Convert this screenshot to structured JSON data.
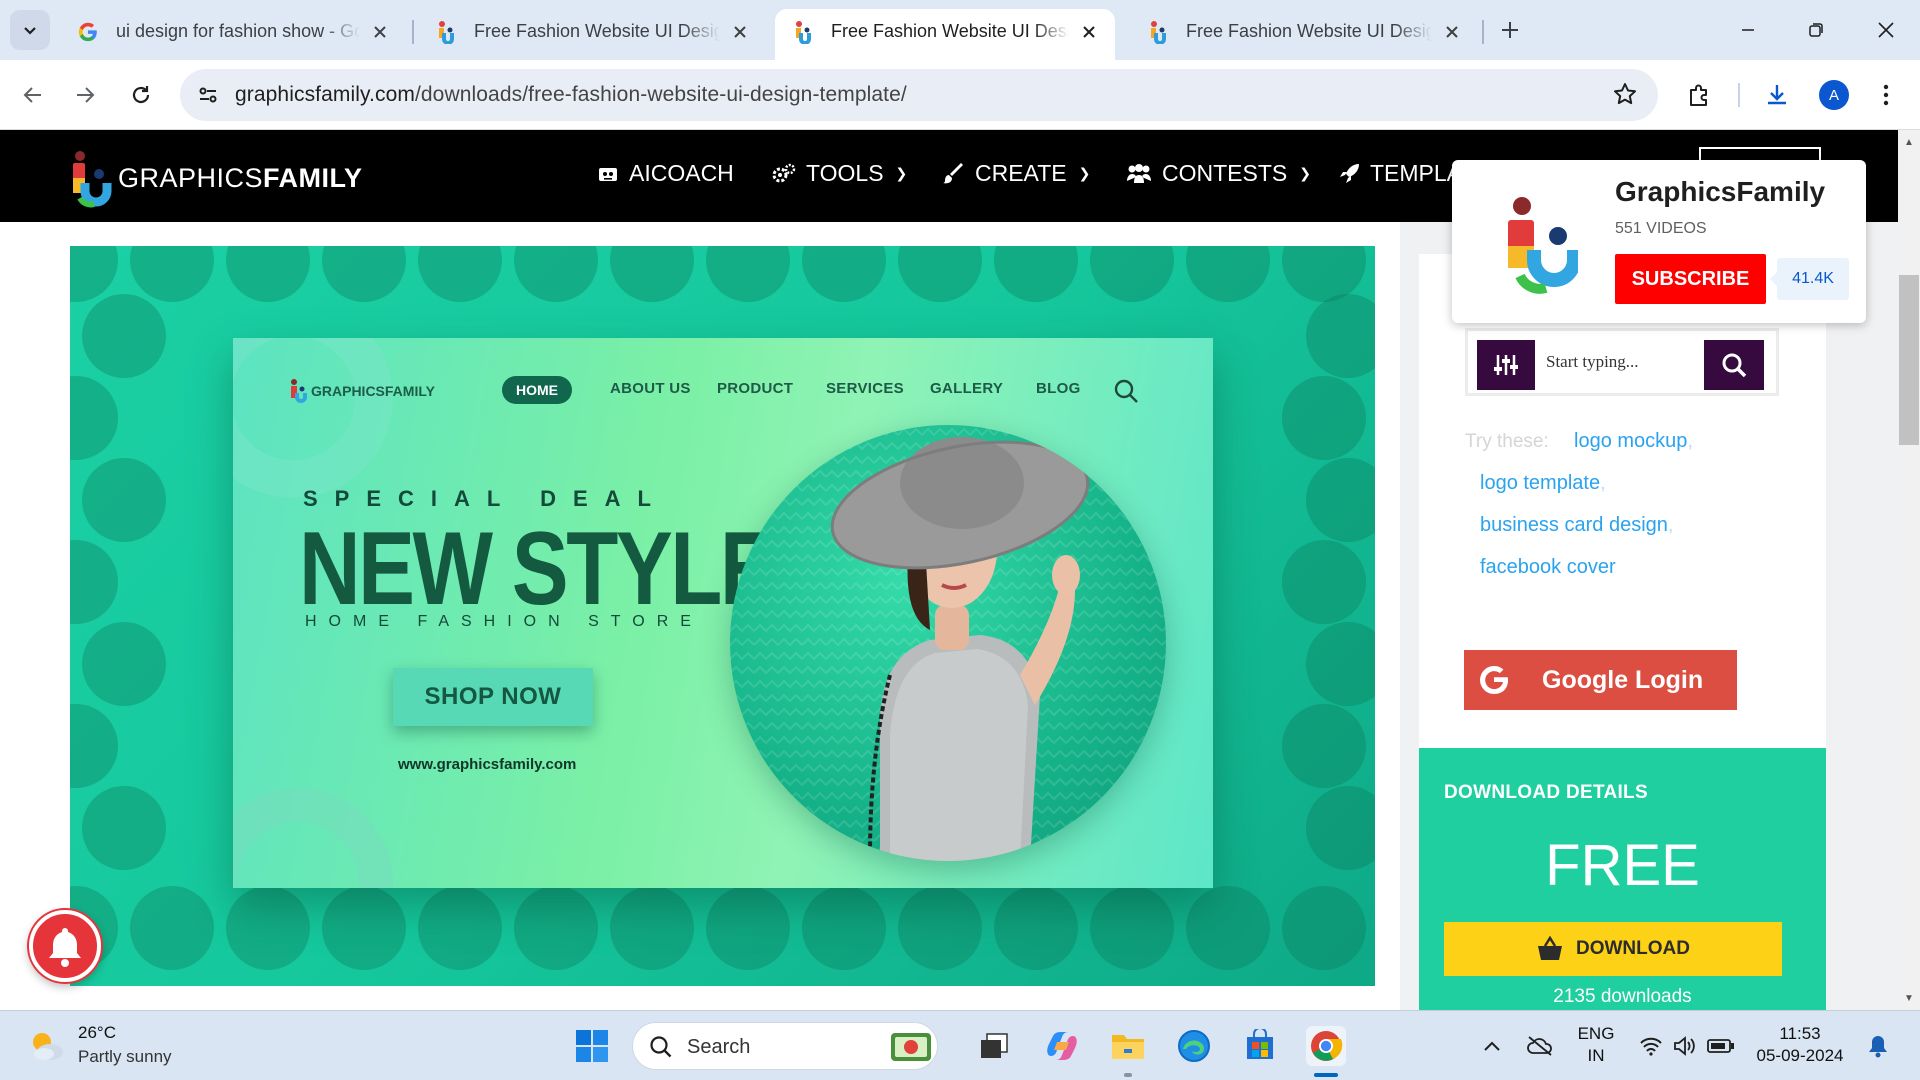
{
  "browser": {
    "tabs": [
      {
        "title": "ui design for fashion show - Go",
        "favicon": "google-icon",
        "active": false
      },
      {
        "title": "Free Fashion Website UI Design",
        "favicon": "graphicsfamily-icon",
        "active": false
      },
      {
        "title": "Free Fashion Website UI Design",
        "favicon": "graphicsfamily-icon",
        "active": true
      },
      {
        "title": "Free Fashion Website UI Design",
        "favicon": "graphicsfamily-icon",
        "active": false
      }
    ],
    "url_domain": "graphicsfamily.com",
    "url_path": "/downloads/free-fashion-website-ui-design-template/",
    "profile_initial": "A"
  },
  "site": {
    "logo_light": "GRAPHICS",
    "logo_bold": "FAMILY",
    "nav": [
      {
        "label": "AICOACH",
        "icon": "robot-icon",
        "dropdown": false
      },
      {
        "label": "TOOLS",
        "icon": "gears-icon",
        "dropdown": true
      },
      {
        "label": "CREATE",
        "icon": "brush-icon",
        "dropdown": true
      },
      {
        "label": "CONTESTS",
        "icon": "users-icon",
        "dropdown": true
      },
      {
        "label": "TEMPLA",
        "icon": "rocket-icon",
        "dropdown": false
      }
    ]
  },
  "hero": {
    "mock_logo": "GRAPHICSFAMILY",
    "mock_nav": [
      "HOME",
      "ABOUT US",
      "PRODUCT",
      "SERVICES",
      "GALLERY",
      "BLOG"
    ],
    "special": "SPECIAL DEAL",
    "headline": "NEW STYLE",
    "subline": "HOME FASHION STORE",
    "cta": "SHOP NOW",
    "url": "www.graphicsfamily.com"
  },
  "sidebar": {
    "search_placeholder": "Start typing...",
    "try_label": "Try these:",
    "tags": [
      "logo mockup",
      "logo template",
      "business card design",
      "facebook cover"
    ],
    "google_login": "Google Login",
    "download": {
      "title": "DOWNLOAD DETAILS",
      "price": "FREE",
      "button": "DOWNLOAD",
      "count": "2135 downloads"
    }
  },
  "youtube": {
    "channel": "GraphicsFamily",
    "videos": "551 VIDEOS",
    "subscribe": "SUBSCRIBE",
    "subscribers": "41.4K"
  },
  "taskbar": {
    "temp": "26°C",
    "weather": "Partly sunny",
    "search": "Search",
    "lang1": "ENG",
    "lang2": "IN",
    "time": "11:53",
    "date": "05-09-2024"
  },
  "colors": {
    "hero_green": "#1bd0a4",
    "download_panel": "#1fcf9f",
    "download_button": "#fdd216",
    "google_red": "#dc4e41",
    "subscribe_red": "#ff0000",
    "search_purple": "#36093f"
  }
}
